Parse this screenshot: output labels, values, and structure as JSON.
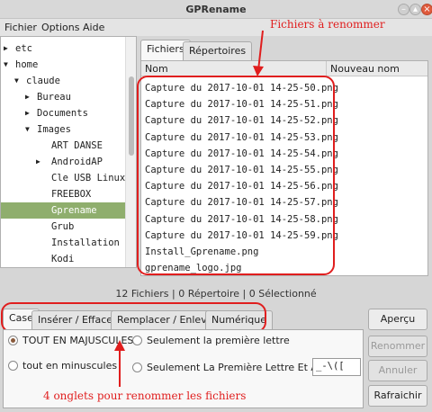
{
  "window": {
    "title": "GPRename"
  },
  "menu": {
    "items": [
      "Fichier",
      "Options",
      "Aide"
    ]
  },
  "tree": {
    "items": [
      {
        "label": "etc",
        "depth": 0,
        "expander": "collapsed"
      },
      {
        "label": "home",
        "depth": 0,
        "expander": "expanded"
      },
      {
        "label": "claude",
        "depth": 1,
        "expander": "expanded"
      },
      {
        "label": "Bureau",
        "depth": 2,
        "expander": "collapsed"
      },
      {
        "label": "Documents",
        "depth": 2,
        "expander": "collapsed"
      },
      {
        "label": "Images",
        "depth": 2,
        "expander": "expanded"
      },
      {
        "label": "ART DANSE",
        "depth": 3,
        "expander": "none"
      },
      {
        "label": "AndroidAP",
        "depth": 3,
        "expander": "collapsed"
      },
      {
        "label": "Cle USB Linux",
        "depth": 3,
        "expander": "none"
      },
      {
        "label": "FREEBOX",
        "depth": 3,
        "expander": "none"
      },
      {
        "label": "Gprename",
        "depth": 3,
        "expander": "none",
        "selected": true
      },
      {
        "label": "Grub",
        "depth": 3,
        "expander": "none"
      },
      {
        "label": "Installation",
        "depth": 3,
        "expander": "none"
      },
      {
        "label": "Kodi",
        "depth": 3,
        "expander": "none"
      }
    ]
  },
  "top_tabs": [
    "Fichiers",
    "Répertoires"
  ],
  "files": {
    "columns": [
      "Nom",
      "Nouveau nom"
    ],
    "rows": [
      "Capture du 2017-10-01 14-25-50.png",
      "Capture du 2017-10-01 14-25-51.png",
      "Capture du 2017-10-01 14-25-52.png",
      "Capture du 2017-10-01 14-25-53.png",
      "Capture du 2017-10-01 14-25-54.png",
      "Capture du 2017-10-01 14-25-55.png",
      "Capture du 2017-10-01 14-25-56.png",
      "Capture du 2017-10-01 14-25-57.png",
      "Capture du 2017-10-01 14-25-58.png",
      "Capture du 2017-10-01 14-25-59.png",
      "Install_Gprename.png",
      "gprename_logo.jpg"
    ]
  },
  "status": {
    "text": "12 Fichiers | 0 Répertoire | 0 Sélectionné"
  },
  "bottom_tabs": [
    "Case",
    "Insérer / Effacer",
    "Remplacer / Enlever",
    "Numérique"
  ],
  "case_options": {
    "upper": "TOUT EN MAJUSCULES",
    "lower": "tout en minuscules",
    "first_letter": "Seulement la première lettre",
    "word_first": "Seulement La Première Lettre Et Après",
    "separators": "_-\\(["
  },
  "buttons": {
    "preview": "Aperçu",
    "rename": "Renommer",
    "cancel": "Annuler",
    "refresh": "Rafraichir"
  },
  "annotations": {
    "top": "Fichiers  à  renommer",
    "bottom": "4  onglets  pour  renommer  les  fichiers"
  },
  "colors": {
    "selection": "#8fae6d",
    "annotation": "#e01e1e",
    "close_button": "#e05a3c"
  }
}
